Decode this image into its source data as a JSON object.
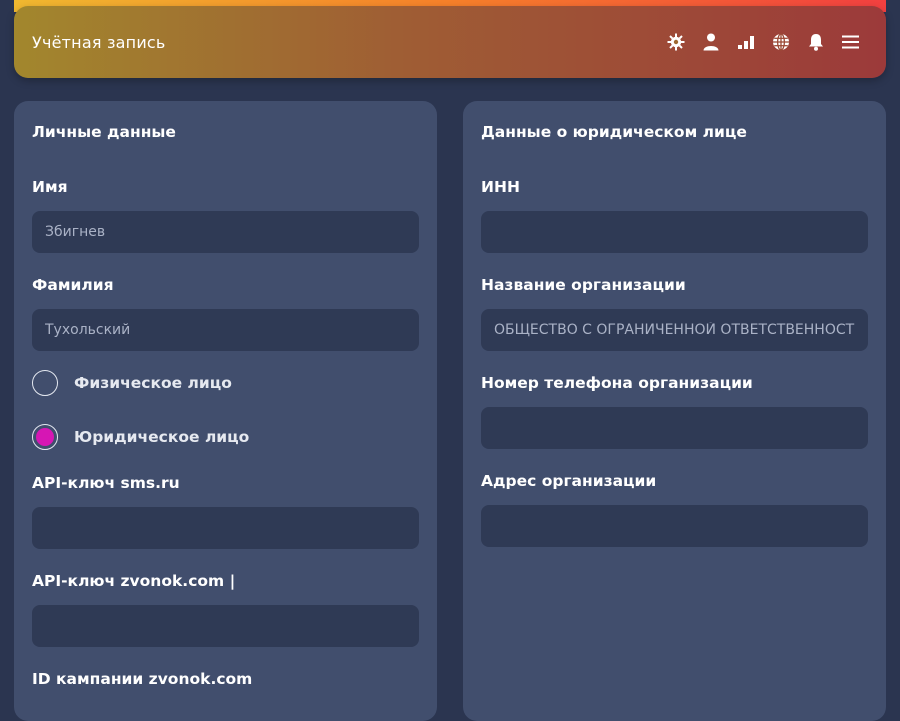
{
  "header": {
    "title": "Учётная запись",
    "icons": [
      "gear-icon",
      "user-icon",
      "chart-icon",
      "globe-icon",
      "bell-icon",
      "menu-icon"
    ]
  },
  "personal": {
    "title": "Личные данные",
    "first_name": {
      "label": "Имя",
      "placeholder": "Збигнев"
    },
    "last_name": {
      "label": "Фамилия",
      "placeholder": "Тухольский"
    },
    "radio_individual": {
      "label": "Физическое лицо",
      "checked": false
    },
    "radio_legal": {
      "label": "Юридическое лицо",
      "checked": true
    },
    "sms_key": {
      "label": "API-ключ sms.ru",
      "value": ""
    },
    "zvonok_key": {
      "label": "API-ключ zvonok.com |",
      "value": ""
    },
    "zvonok_campaign": {
      "label": "ID кампании zvonok.com"
    }
  },
  "legal": {
    "title": "Данные о юридическом лице",
    "inn": {
      "label": "ИНН",
      "value": ""
    },
    "org_name": {
      "label": "Название организации",
      "placeholder": "ОБЩЕСТВО С ОГРАНИЧЕННОЙ ОТВЕТСТВЕННОСТЬЮ"
    },
    "org_phone": {
      "label": "Номер телефона организации",
      "value": ""
    },
    "org_address": {
      "label": "Адрес организации",
      "value": ""
    }
  },
  "colors": {
    "accent_radio": "#d616b4",
    "card_bg": "#414e6d",
    "input_bg": "#2f3a55",
    "page_bg": "#2b3550"
  }
}
